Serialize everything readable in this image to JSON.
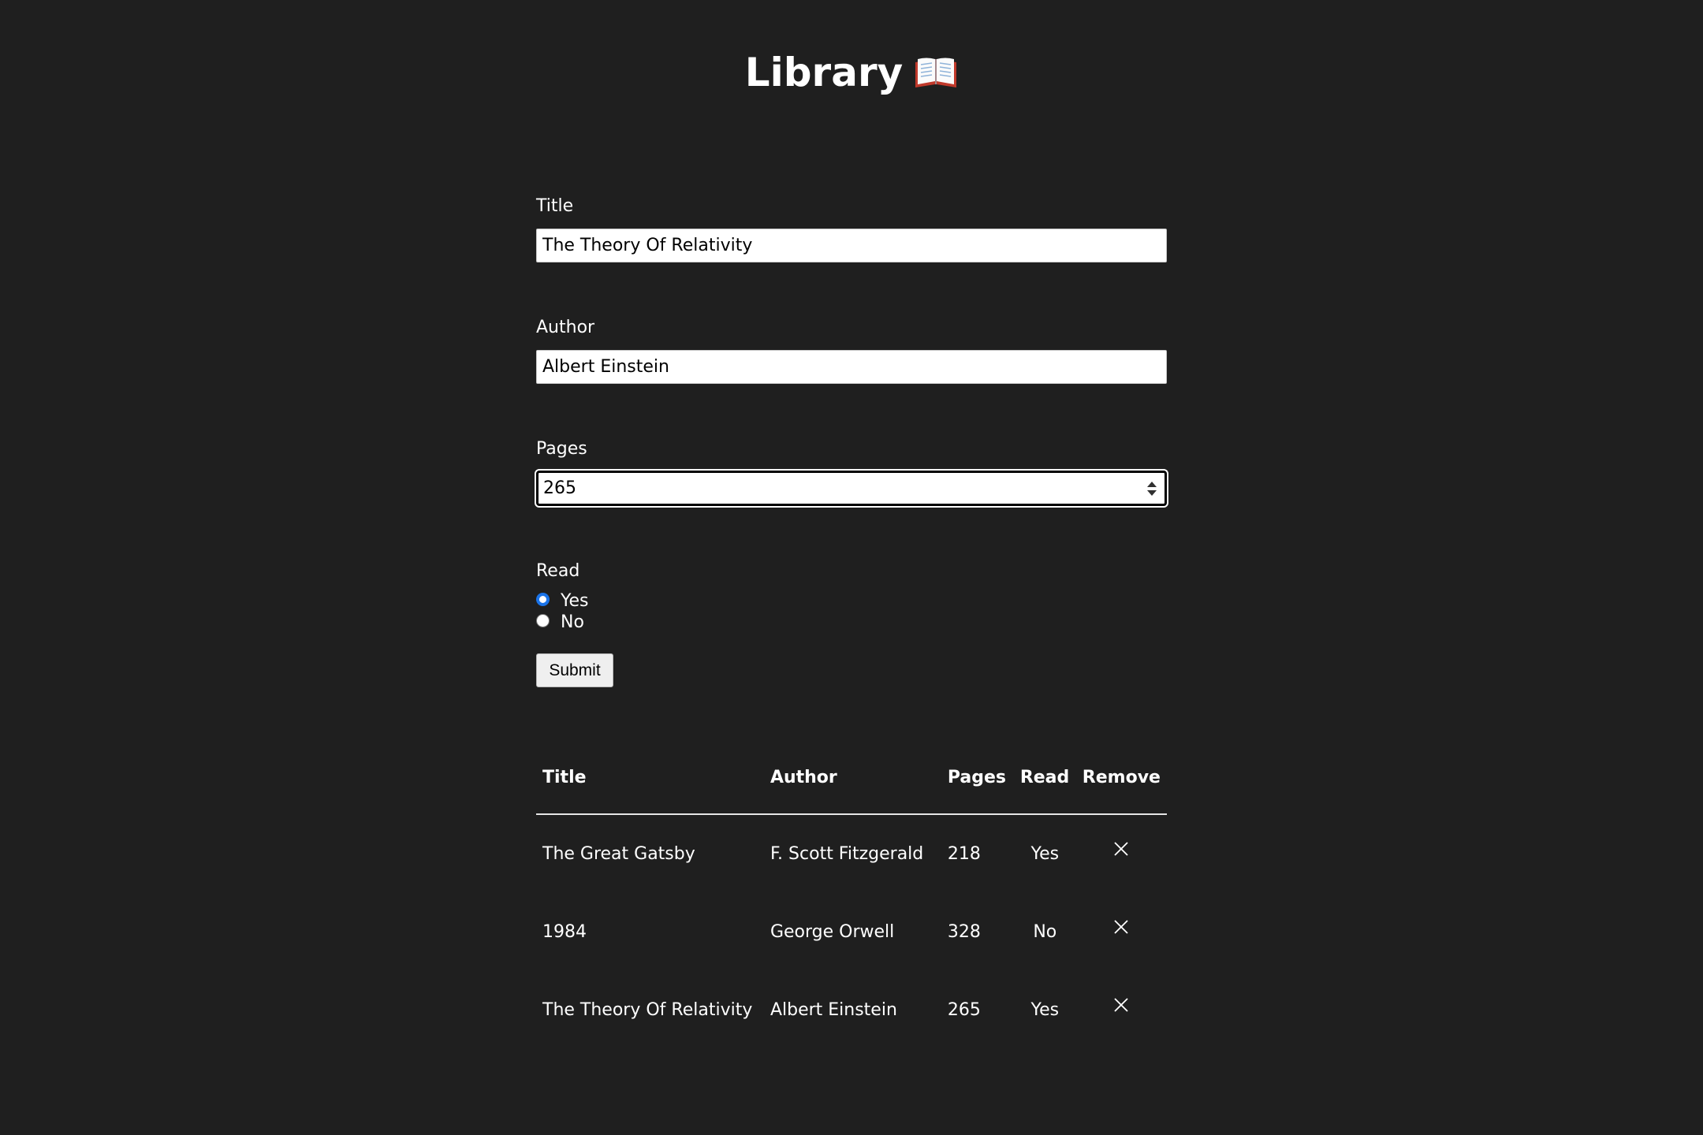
{
  "header": {
    "title": "Library",
    "icon": "open-book-icon"
  },
  "form": {
    "title_label": "Title",
    "title_value": "The Theory Of Relativity",
    "author_label": "Author",
    "author_value": "Albert Einstein",
    "pages_label": "Pages",
    "pages_value": "265",
    "read_label": "Read",
    "read_options": [
      "Yes",
      "No"
    ],
    "read_selected": "Yes",
    "submit_label": "Submit"
  },
  "table": {
    "headers": [
      "Title",
      "Author",
      "Pages",
      "Read",
      "Remove"
    ],
    "rows": [
      {
        "title": "The Great Gatsby",
        "author": "F. Scott Fitzgerald",
        "pages": "218",
        "read": "Yes",
        "remove_icon": "close-icon"
      },
      {
        "title": "1984",
        "author": "George Orwell",
        "pages": "328",
        "read": "No",
        "remove_icon": "close-icon"
      },
      {
        "title": "The Theory Of Relativity",
        "author": "Albert Einstein",
        "pages": "265",
        "read": "Yes",
        "remove_icon": "close-icon"
      }
    ]
  },
  "colors": {
    "background": "#1f1f1f",
    "text": "#ffffff",
    "radio_accent": "#1a73e8"
  }
}
